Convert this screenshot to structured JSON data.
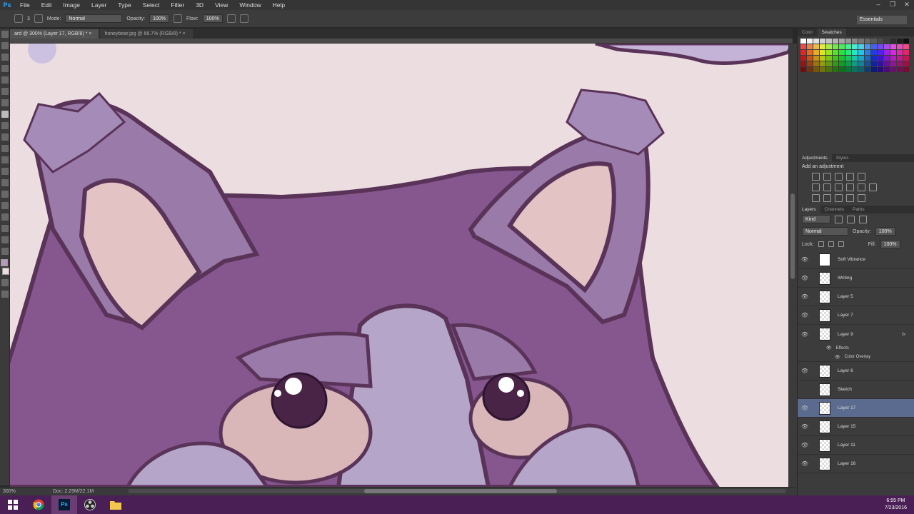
{
  "menubar": {
    "app_logo": "Ps",
    "items": [
      "File",
      "Edit",
      "Image",
      "Layer",
      "Type",
      "Select",
      "Filter",
      "3D",
      "View",
      "Window",
      "Help"
    ]
  },
  "options": {
    "brush_size": "3",
    "mode_label": "Mode:",
    "mode_value": "Normal",
    "opacity_label": "Opacity:",
    "opacity_value": "100%",
    "flow_label": "Flow:",
    "flow_value": "100%",
    "workspace": "Essentials"
  },
  "tabs": [
    {
      "label": "ard @ 300% (Layer 17, RGB/8) *"
    },
    {
      "label": "honeybear.jpg @ 66.7% (RGB/8) *"
    }
  ],
  "status": {
    "zoom": "300%",
    "doc": "Doc: 2.29M/22.1M"
  },
  "panels": {
    "swatches_tabs": [
      "Color",
      "Swatches"
    ],
    "adjustments_tabs": [
      "Adjustments",
      "Styles"
    ],
    "adjustments_title": "Add an adjustment",
    "layers_tabs": [
      "Layers",
      "Channels",
      "Paths"
    ],
    "kind_label": "Kind",
    "blend_mode": "Normal",
    "opacity_label": "Opacity:",
    "opacity_value": "100%",
    "lock_label": "Lock:",
    "fill_label": "Fill:",
    "fill_value": "100%",
    "effects_label": "Effects",
    "color_overlay_label": "Color Overlay",
    "fx_label": "fx"
  },
  "layers": [
    {
      "name": "Soft Vibrance",
      "visible": true,
      "selected": false
    },
    {
      "name": "Writing",
      "visible": true,
      "selected": false
    },
    {
      "name": "Layer 5",
      "visible": true,
      "selected": false
    },
    {
      "name": "Layer 7",
      "visible": true,
      "selected": false
    },
    {
      "name": "Layer 9",
      "visible": true,
      "selected": false
    },
    {
      "name": "Layer 6",
      "visible": true,
      "selected": false
    },
    {
      "name": "Sketch",
      "visible": false,
      "selected": false
    },
    {
      "name": "Layer 17",
      "visible": true,
      "selected": true
    },
    {
      "name": "Layer 15",
      "visible": true,
      "selected": false
    },
    {
      "name": "Layer 11",
      "visible": true,
      "selected": false
    },
    {
      "name": "Layer 16",
      "visible": true,
      "selected": false
    }
  ],
  "clock": {
    "time": "6:55 PM",
    "date": "7/23/2016"
  },
  "colors": {
    "canvas_bg": "#ecdde0",
    "fur": "#86578f",
    "fur_light": "#9a7aa8",
    "outline": "#5a3358",
    "inner_ear": "#e3c3c4",
    "selected_layer": "#5b6b8f",
    "taskbar": "#4a1f55"
  }
}
